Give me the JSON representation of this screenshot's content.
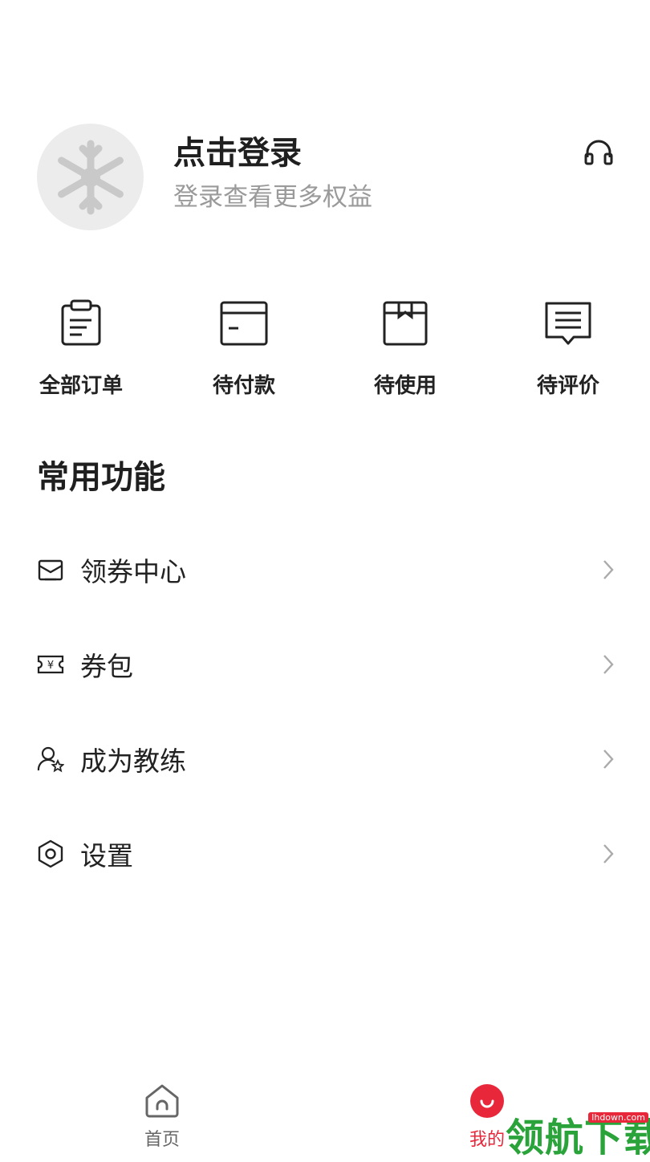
{
  "profile": {
    "title": "点击登录",
    "subtitle": "登录查看更多权益",
    "support_icon": "headset-icon",
    "avatar_icon": "snowflake-icon"
  },
  "orders": [
    {
      "label": "全部订单",
      "icon": "clipboard-icon"
    },
    {
      "label": "待付款",
      "icon": "card-icon"
    },
    {
      "label": "待使用",
      "icon": "box-icon"
    },
    {
      "label": "待评价",
      "icon": "comment-icon"
    }
  ],
  "section_title": "常用功能",
  "features": [
    {
      "label": "领券中心",
      "icon": "coupon-center-icon"
    },
    {
      "label": "券包",
      "icon": "ticket-icon"
    },
    {
      "label": "成为教练",
      "icon": "coach-icon"
    },
    {
      "label": "设置",
      "icon": "settings-icon"
    }
  ],
  "nav": {
    "home_label": "首页",
    "mine_label": "我的"
  },
  "watermark": {
    "text": "领航下载",
    "url": "lhdown.com"
  },
  "colors": {
    "accent": "#e8283a",
    "subtitle": "#9a9a9a",
    "watermark_green": "#2aa33a"
  }
}
